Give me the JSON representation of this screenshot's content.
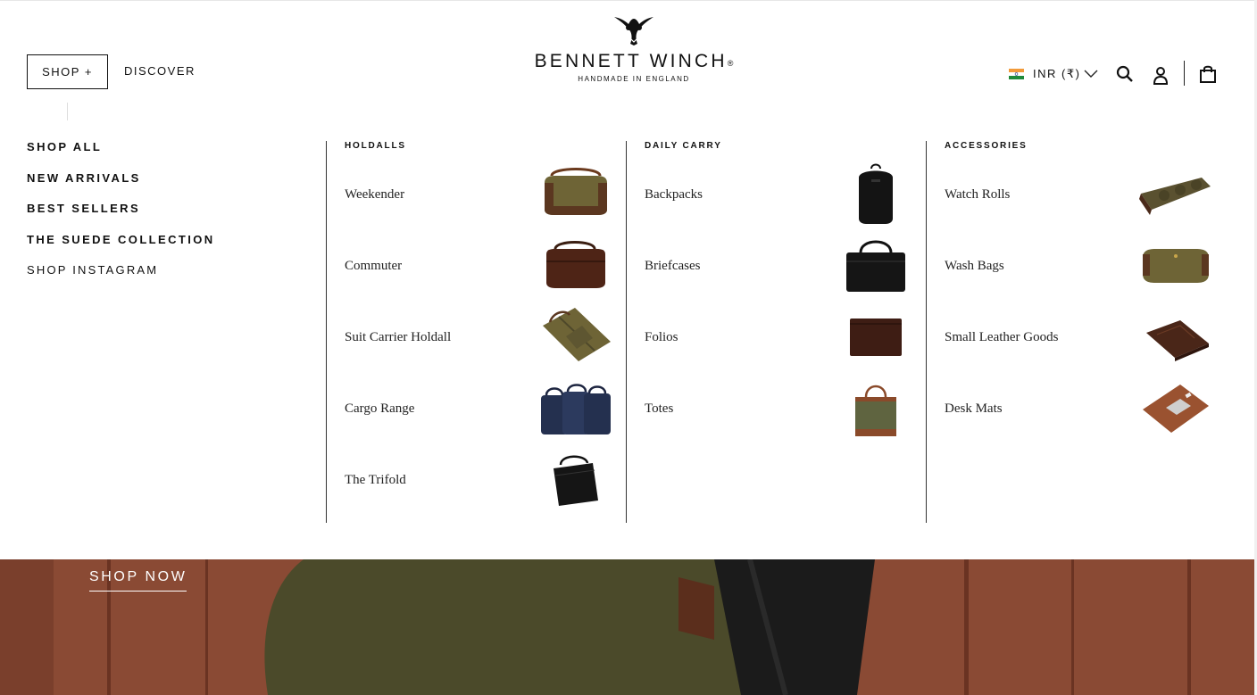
{
  "header": {
    "shop_label": "SHOP +",
    "discover_label": "DISCOVER",
    "logo": {
      "name": "BENNETT WINCH",
      "reg": "®",
      "tagline": "HANDMADE IN ENGLAND"
    },
    "currency": "INR (₹)",
    "icons": [
      "search-icon",
      "account-icon",
      "cart-icon"
    ]
  },
  "menu": {
    "left": [
      "SHOP ALL",
      "NEW ARRIVALS",
      "BEST SELLERS",
      "THE SUEDE COLLECTION",
      "SHOP INSTAGRAM"
    ],
    "columns": [
      {
        "title": "HOLDALLS",
        "items": [
          "Weekender",
          "Commuter",
          "Suit Carrier Holdall",
          "Cargo Range",
          "The Trifold"
        ]
      },
      {
        "title": "DAILY CARRY",
        "items": [
          "Backpacks",
          "Briefcases",
          "Folios",
          "Totes"
        ]
      },
      {
        "title": "ACCESSORIES",
        "items": [
          "Watch Rolls",
          "Wash Bags",
          "Small Leather Goods",
          "Desk Mats"
        ]
      }
    ]
  },
  "hero": {
    "cta": "SHOP NOW"
  },
  "colors": {
    "text": "#111111",
    "hero_wood": "#8a4a34",
    "olive": "#5f5a2e"
  }
}
